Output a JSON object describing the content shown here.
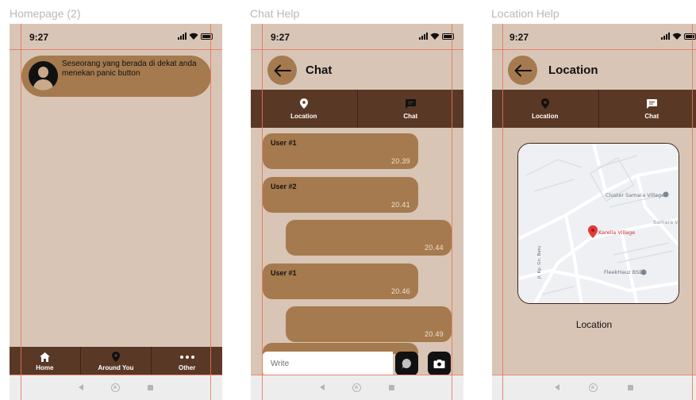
{
  "frames": {
    "homepage_title": "Homepage (2)",
    "chat_title": "Chat Help",
    "location_title": "Location Help"
  },
  "status": {
    "time": "9:27"
  },
  "homepage": {
    "notification": "Seseorang yang berada di dekat anda menekan panic button",
    "nav": [
      {
        "label": "Home",
        "icon": "home-icon"
      },
      {
        "label": "Around You",
        "icon": "location-pin-icon"
      },
      {
        "label": "Other",
        "icon": "more-dots-icon"
      }
    ]
  },
  "tabs": {
    "location": "Location",
    "chat": "Chat"
  },
  "chat": {
    "title": "Chat",
    "messages": [
      {
        "sender": "User #1",
        "time": "20.39",
        "side": "left"
      },
      {
        "sender": "User #2",
        "time": "20.41",
        "side": "left"
      },
      {
        "sender": "",
        "time": "20.44",
        "side": "right"
      },
      {
        "sender": "User #1",
        "time": "20.46",
        "side": "left"
      },
      {
        "sender": "",
        "time": "20.49",
        "side": "right"
      }
    ],
    "input_placeholder": "Write"
  },
  "location": {
    "title": "Location",
    "caption": "Location",
    "map_labels": {
      "poi1": "Cluster Samara Village",
      "poi2": "Samara Vil",
      "marker": "Karelia Village",
      "poi3": "FleekHauz BSD",
      "street": "Jl. Kp. Gn. Batu"
    }
  },
  "colors": {
    "background": "#d9c5b6",
    "bubble": "#a57a4e",
    "dark_bar": "#5a3826",
    "guides": "#e8735a"
  }
}
